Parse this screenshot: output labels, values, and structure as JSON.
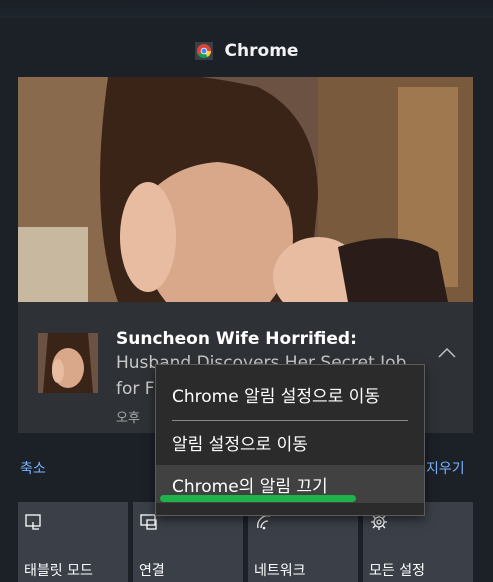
{
  "header": {
    "app_name": "Chrome",
    "app_icon": "chrome-icon"
  },
  "notification": {
    "title": "Suncheon Wife Horrified:",
    "line2": "Husband Discovers Her Secret Job",
    "line3": "for F",
    "time": "오후",
    "expand_icon": "chevron-up-icon"
  },
  "action_center": {
    "collapse_label": "축소",
    "clear_label": "지우기"
  },
  "tiles": [
    {
      "label": "태블릿 모드",
      "icon": "tablet-mode-icon"
    },
    {
      "label": "연결",
      "icon": "connect-icon"
    },
    {
      "label": "네트워크",
      "icon": "network-icon"
    },
    {
      "label": "모든 설정",
      "icon": "settings-gear-icon"
    }
  ],
  "context_menu": {
    "items": [
      {
        "label": "Chrome 알림 설정으로 이동"
      },
      {
        "label": "알림 설정으로 이동"
      },
      {
        "label": "Chrome의 알림 끄기"
      }
    ],
    "highlight_color": "#1fb24a"
  }
}
